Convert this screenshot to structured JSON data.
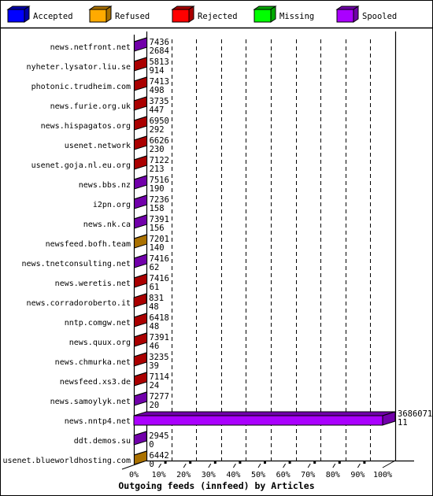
{
  "legend": [
    {
      "label": "Accepted",
      "color": "#0000ff",
      "shade": "#0000aa"
    },
    {
      "label": "Refused",
      "color": "#ffaa00",
      "shade": "#aa7100"
    },
    {
      "label": "Rejected",
      "color": "#ff0000",
      "shade": "#aa0000"
    },
    {
      "label": "Missing",
      "color": "#00ff00",
      "shade": "#00aa00"
    },
    {
      "label": "Spooled",
      "color": "#aa00ff",
      "shade": "#7100aa"
    }
  ],
  "chart_data": {
    "type": "bar",
    "orientation": "horizontal",
    "stacked": true,
    "three_d": true,
    "title": "Outgoing feeds (innfeed) by Articles",
    "xlabel": "",
    "ylabel": "",
    "xlim": [
      0,
      100
    ],
    "x_unit": "%",
    "x_ticks": [
      "0%",
      "10%",
      "20%",
      "30%",
      "40%",
      "50%",
      "60%",
      "70%",
      "80%",
      "90%",
      "100%"
    ],
    "grid": true,
    "legend_position": "top",
    "rows": [
      {
        "host": "news.netfront.net",
        "value_top": 7436,
        "value_bottom": 2684,
        "segment": "Spooled"
      },
      {
        "host": "nyheter.lysator.liu.se",
        "value_top": 5813,
        "value_bottom": 914,
        "segment": "Rejected"
      },
      {
        "host": "photonic.trudheim.com",
        "value_top": 7413,
        "value_bottom": 498,
        "segment": "Rejected"
      },
      {
        "host": "news.furie.org.uk",
        "value_top": 3735,
        "value_bottom": 447,
        "segment": "Rejected"
      },
      {
        "host": "news.hispagatos.org",
        "value_top": 6950,
        "value_bottom": 292,
        "segment": "Rejected"
      },
      {
        "host": "usenet.network",
        "value_top": 6626,
        "value_bottom": 230,
        "segment": "Rejected"
      },
      {
        "host": "usenet.goja.nl.eu.org",
        "value_top": 7122,
        "value_bottom": 213,
        "segment": "Rejected"
      },
      {
        "host": "news.bbs.nz",
        "value_top": 7516,
        "value_bottom": 190,
        "segment": "Spooled"
      },
      {
        "host": "i2pn.org",
        "value_top": 7236,
        "value_bottom": 158,
        "segment": "Spooled"
      },
      {
        "host": "news.nk.ca",
        "value_top": 7391,
        "value_bottom": 156,
        "segment": "Spooled"
      },
      {
        "host": "newsfeed.bofh.team",
        "value_top": 7201,
        "value_bottom": 140,
        "segment": "Refused"
      },
      {
        "host": "news.tnetconsulting.net",
        "value_top": 7416,
        "value_bottom": 62,
        "segment": "Spooled"
      },
      {
        "host": "news.weretis.net",
        "value_top": 7416,
        "value_bottom": 61,
        "segment": "Rejected"
      },
      {
        "host": "news.corradoroberto.it",
        "value_top": 831,
        "value_bottom": 48,
        "segment": "Rejected"
      },
      {
        "host": "nntp.comgw.net",
        "value_top": 6418,
        "value_bottom": 48,
        "segment": "Rejected"
      },
      {
        "host": "news.quux.org",
        "value_top": 7391,
        "value_bottom": 46,
        "segment": "Rejected"
      },
      {
        "host": "news.chmurka.net",
        "value_top": 3235,
        "value_bottom": 39,
        "segment": "Rejected"
      },
      {
        "host": "newsfeed.xs3.de",
        "value_top": 7114,
        "value_bottom": 24,
        "segment": "Rejected"
      },
      {
        "host": "news.samoylyk.net",
        "value_top": 7277,
        "value_bottom": 20,
        "segment": "Spooled"
      },
      {
        "host": "news.nntp4.net",
        "value_top": 3686071,
        "value_bottom": 11,
        "segment": "Spooled"
      },
      {
        "host": "ddt.demos.su",
        "value_top": 2945,
        "value_bottom": 0,
        "segment": "Spooled"
      },
      {
        "host": "usenet.blueworldhosting.com",
        "value_top": 6442,
        "value_bottom": 0,
        "segment": "Refused"
      }
    ]
  }
}
